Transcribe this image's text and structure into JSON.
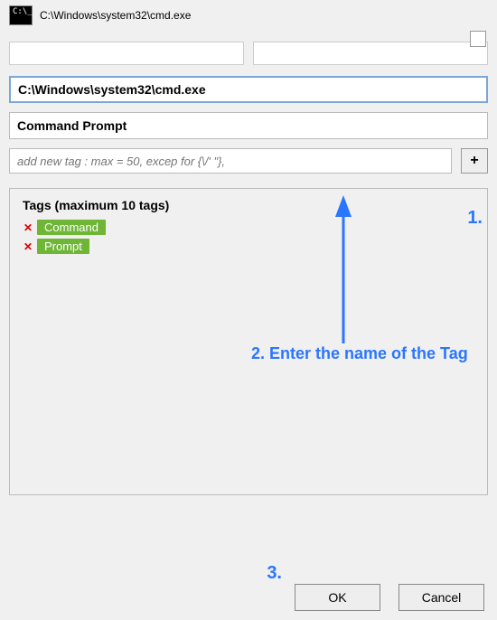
{
  "titlebar": {
    "icon_text": "C:\\_",
    "title": "C:\\Windows\\system32\\cmd.exe"
  },
  "top_inputs": {
    "left_value": "",
    "right_value": ""
  },
  "path_value": "C:\\Windows\\system32\\cmd.exe",
  "window_title_value": "Command Prompt",
  "add_tag": {
    "placeholder": "add new tag : max = 50, excep for {\\/' \"},",
    "button_label": "+"
  },
  "tags_section": {
    "heading": "Tags (maximum 10 tags)",
    "items": [
      {
        "label": "Command"
      },
      {
        "label": "Prompt"
      }
    ]
  },
  "buttons": {
    "ok": "OK",
    "cancel": "Cancel"
  },
  "annotations": {
    "n1": "1.",
    "n2": "2. Enter the name of the Tag",
    "n3": "3."
  }
}
